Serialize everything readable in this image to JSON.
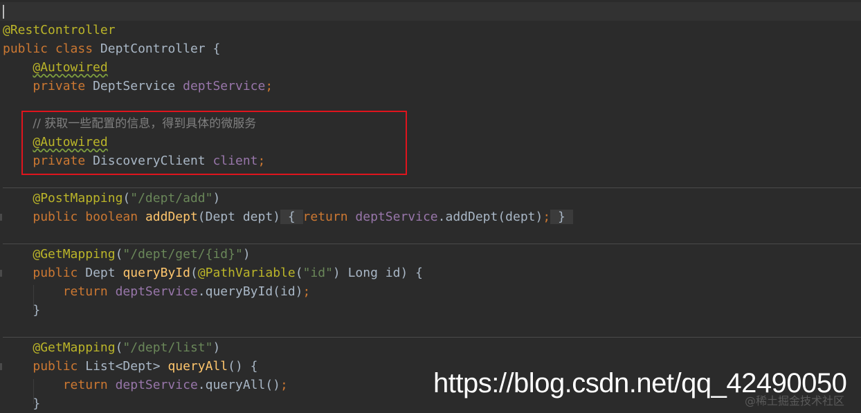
{
  "code": {
    "line1_annotation": "@RestController",
    "line2": {
      "kw1": "public",
      "kw2": "class",
      "name": "DeptController",
      "brace": "{"
    },
    "line3_annotation": "@Autowired",
    "line4": {
      "kw": "private",
      "type": "DeptService",
      "field": "deptService",
      "semi": ";"
    },
    "line6_comment": "// 获取一些配置的信息，得到具体的微服务",
    "line7_annotation": "@Autowired",
    "line8": {
      "kw": "private",
      "type": "DiscoveryClient",
      "field": "client",
      "semi": ";"
    },
    "line10": {
      "annotation": "@PostMapping",
      "open": "(",
      "path": "\"/dept/add\"",
      "close": ")"
    },
    "line11": {
      "kw1": "public",
      "kw2": "boolean",
      "method": "addDept",
      "params": "(Dept dept)",
      "brace_open": "{",
      "kw3": "return",
      "field": "deptService",
      "call": ".addDept(dept)",
      "semi": ";",
      "brace_close": "}"
    },
    "line13": {
      "annotation": "@GetMapping",
      "open": "(",
      "path": "\"/dept/get/{id}\"",
      "close": ")"
    },
    "line14": {
      "kw": "public",
      "type": "Dept",
      "method": "queryById",
      "open": "(",
      "param_ann": "@PathVariable",
      "p_open": "(",
      "param_str": "\"id\"",
      "rest": ") Long id) {"
    },
    "line15": {
      "kw": "return",
      "field": "deptService",
      "call": ".queryById(id)",
      "semi": ";"
    },
    "line16": "}",
    "line18": {
      "annotation": "@GetMapping",
      "open": "(",
      "path": "\"/dept/list\"",
      "close": ")"
    },
    "line19": {
      "kw": "public",
      "type": "List<Dept>",
      "method": "queryAll",
      "rest": "() {"
    },
    "line20": {
      "kw": "return",
      "field": "deptService",
      "call": ".queryAll()",
      "semi": ";"
    },
    "line21": "}"
  },
  "watermark": {
    "url": "https://blog.csdn.net/qq_42490050",
    "faint": "@稀土掘金技术社区"
  },
  "colors": {
    "background": "#2b2b2b",
    "keyword": "#cc7832",
    "annotation": "#bbb529",
    "field": "#9876aa",
    "string": "#6a8759",
    "method": "#ffc66d",
    "comment": "#808080",
    "highlight_box": "#e0141d"
  }
}
